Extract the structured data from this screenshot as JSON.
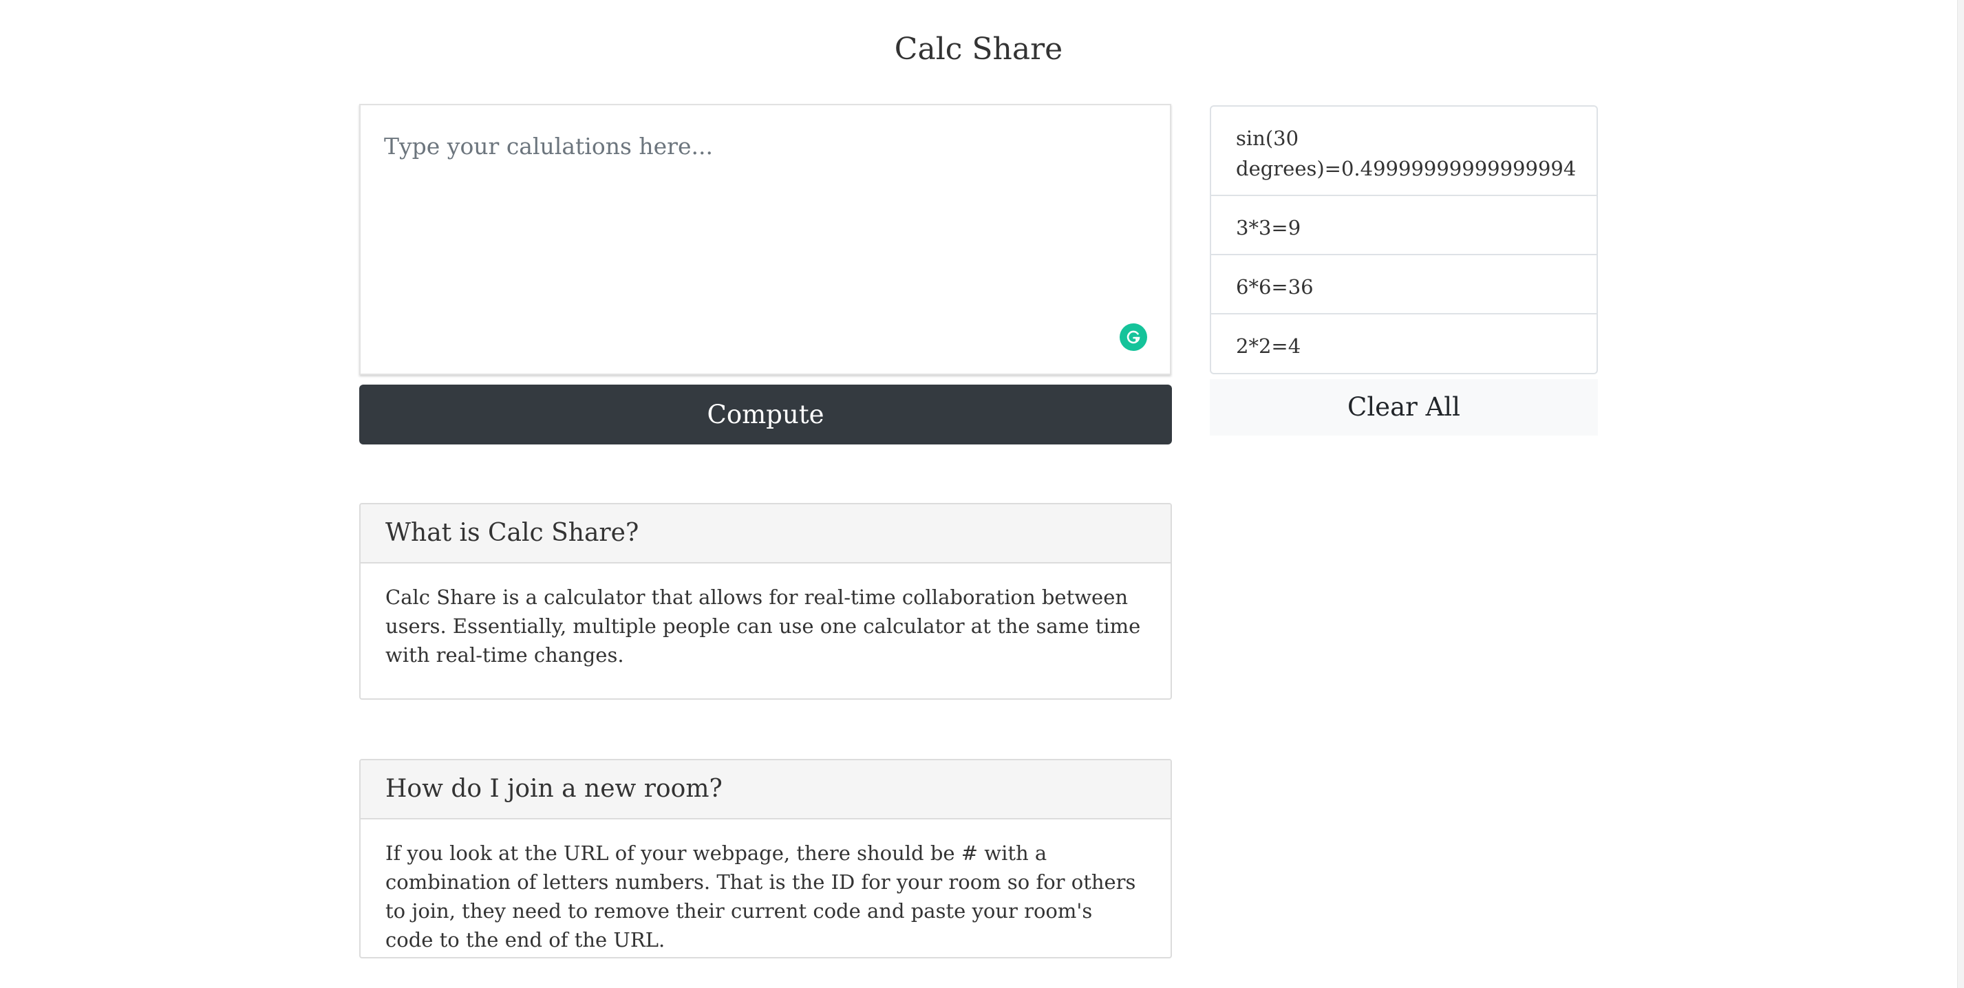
{
  "page": {
    "title": "Calc Share"
  },
  "calculator": {
    "placeholder": "Type your calulations here...",
    "value": "",
    "compute_label": "Compute"
  },
  "history": {
    "items": [
      {
        "text": "sin(30\ndegrees)=0.49999999999999994"
      },
      {
        "text": "3*3=9"
      },
      {
        "text": "6*6=36"
      },
      {
        "text": "2*2=4"
      }
    ],
    "clear_label": "Clear All"
  },
  "faq": [
    {
      "question": "What is Calc Share?",
      "answer": "Calc Share is a calculator that allows for real-time collaboration between users. Essentially, multiple people can use one calculator at the same time with real-time changes."
    },
    {
      "question": "How do I join a new room?",
      "answer": "If you look at the URL of your webpage, there should be # with a combination of letters numbers. That is the ID for your room so for others to join, they need to remove their current code and paste your room's code to the end of the URL."
    }
  ],
  "colors": {
    "compute_button": "#343a40",
    "clear_button": "#f8f9fa",
    "grammarly_badge": "#15c39a"
  },
  "icons": {
    "grammarly": "grammarly-icon"
  }
}
